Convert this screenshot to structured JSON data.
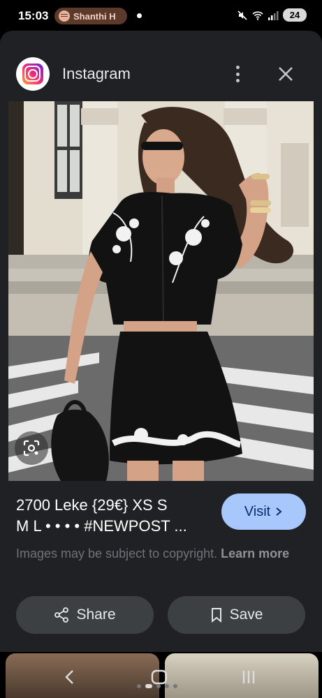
{
  "status_bar": {
    "time": "15:03",
    "media_text": "Shanthi H",
    "battery": "24"
  },
  "header": {
    "app_name": "Instagram"
  },
  "caption": {
    "line1": "2700 Leke {29€} XS S",
    "line2": "M L • • • • #NEWPOST ..."
  },
  "visit_label": "Visit",
  "copyright": {
    "text": "Images may be subject to copyright.",
    "link": "Learn more"
  },
  "actions": {
    "share_label": "Share",
    "save_label": "Save"
  },
  "colors": {
    "sheet_bg": "#202124",
    "visit_bg": "#a8c7fa",
    "pill_bg": "#3c4043"
  }
}
